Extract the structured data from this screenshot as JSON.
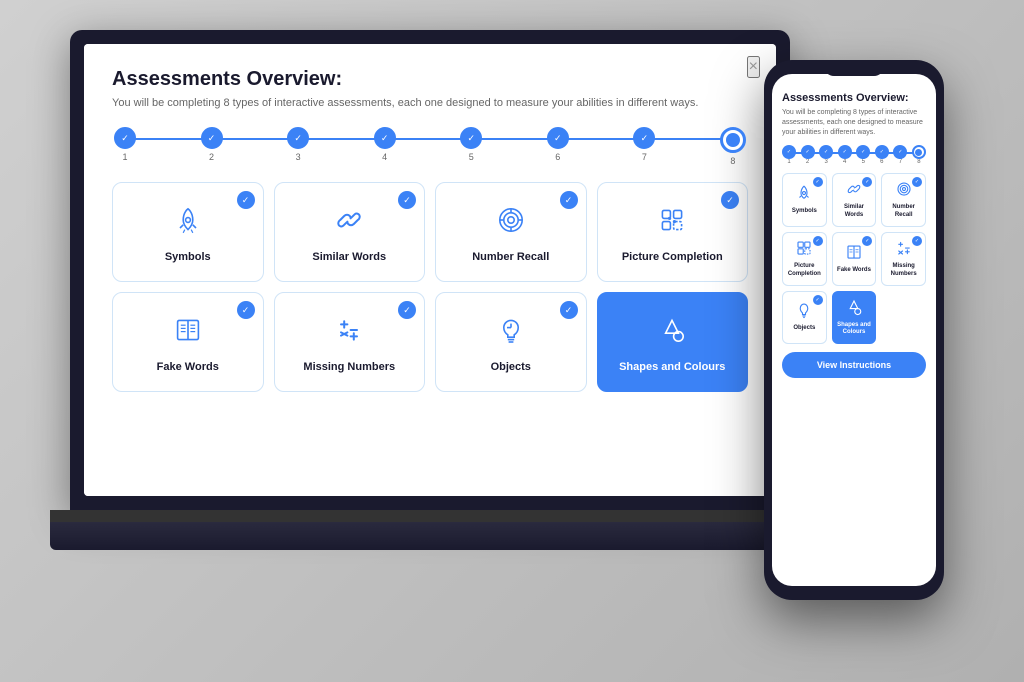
{
  "scene": {
    "bg_color": "#c8c8c8"
  },
  "laptop": {
    "modal": {
      "title": "Assessments Overview:",
      "subtitle": "You will be completing 8 types of interactive assessments, each one designed to measure your abilities in different ways.",
      "close_label": "×",
      "steps": [
        1,
        2,
        3,
        4,
        5,
        6,
        7,
        8
      ],
      "cards": [
        {
          "id": "symbols",
          "label": "Symbols",
          "icon": "rocket",
          "checked": true,
          "active": false
        },
        {
          "id": "similar-words",
          "label": "Similar Words",
          "icon": "link",
          "checked": true,
          "active": false
        },
        {
          "id": "number-recall",
          "label": "Number Recall",
          "icon": "target",
          "checked": true,
          "active": false
        },
        {
          "id": "picture-completion",
          "label": "Picture Completion",
          "icon": "puzzle",
          "checked": true,
          "active": false
        },
        {
          "id": "fake-words",
          "label": "Fake Words",
          "icon": "book",
          "checked": true,
          "active": false
        },
        {
          "id": "missing-numbers",
          "label": "Missing Numbers",
          "icon": "math",
          "checked": true,
          "active": false
        },
        {
          "id": "objects",
          "label": "Objects",
          "icon": "bulb",
          "checked": true,
          "active": false
        },
        {
          "id": "shapes-colours",
          "label": "Shapes and Colours",
          "icon": "shapes",
          "checked": false,
          "active": true
        }
      ]
    }
  },
  "phone": {
    "title": "Assessments Overview:",
    "subtitle": "You will be completing 8 types of interactive assessments, each one designed to measure your abilities in different ways.",
    "steps": [
      1,
      2,
      3,
      4,
      5,
      6,
      7,
      8
    ],
    "cards": [
      {
        "id": "symbols",
        "label": "Symbols",
        "icon": "rocket",
        "checked": true,
        "active": false
      },
      {
        "id": "similar-words",
        "label": "Similar Words",
        "icon": "link",
        "checked": true,
        "active": false
      },
      {
        "id": "number-recall",
        "label": "Number Recall",
        "icon": "target",
        "checked": true,
        "active": false
      },
      {
        "id": "picture-completion",
        "label": "Picture Completion",
        "icon": "puzzle",
        "checked": true,
        "active": false
      },
      {
        "id": "fake-words",
        "label": "Fake Words",
        "icon": "book",
        "checked": true,
        "active": false
      },
      {
        "id": "missing-numbers",
        "label": "Missing Numbers",
        "icon": "math",
        "checked": true,
        "active": false
      },
      {
        "id": "objects",
        "label": "Objects",
        "icon": "bulb",
        "checked": true,
        "active": false
      },
      {
        "id": "shapes-colours",
        "label": "Shapes and Colours",
        "icon": "shapes",
        "checked": false,
        "active": true
      }
    ],
    "button_label": "View Instructions"
  }
}
